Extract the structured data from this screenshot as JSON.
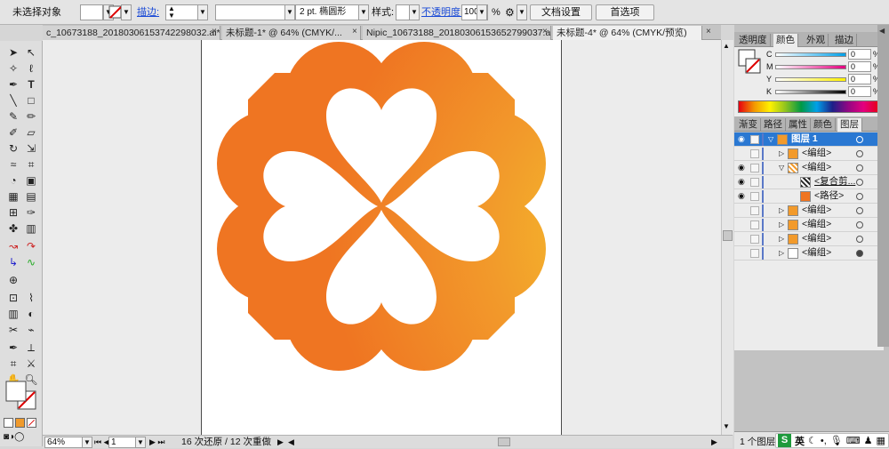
{
  "control": {
    "selection": "未选择对象",
    "stroke_label": "描边:",
    "stroke_preset": "2 pt. 椭圆形",
    "style_label": "样式:",
    "opacity_label": "不透明度:",
    "opacity_value": "100",
    "percent": "%",
    "doc_setup": "文档设置",
    "preferences": "首选项"
  },
  "tabs": [
    {
      "label": "c_10673188_20180306153742298032.ai*",
      "close": "×"
    },
    {
      "label": "未标题-1* @ 64% (CMYK/...",
      "close": "×"
    },
    {
      "label": "Nipic_10673188_20180306153652799037.ai*",
      "close": "×"
    },
    {
      "label": "未标题-4* @ 64% (CMYK/预览)",
      "close": "×"
    }
  ],
  "color_panel": {
    "tabs": [
      "透明度",
      "颜色",
      "外观",
      "描边"
    ],
    "channels": [
      {
        "label": "C",
        "value": "0",
        "pct": "%"
      },
      {
        "label": "M",
        "value": "0",
        "pct": "%"
      },
      {
        "label": "Y",
        "value": "0",
        "pct": "%"
      },
      {
        "label": "K",
        "value": "0",
        "pct": "%"
      }
    ]
  },
  "layers_panel": {
    "tabs": [
      "渐变",
      "路径",
      "属性",
      "颜色",
      "图层"
    ],
    "rows": [
      {
        "label": "图层 1",
        "level": 0,
        "expanded": true
      },
      {
        "label": "<编组>",
        "level": 1
      },
      {
        "label": "<编组>",
        "level": 1,
        "expanded": true
      },
      {
        "label": "<复合剪...",
        "level": 2
      },
      {
        "label": "<路径>",
        "level": 2
      },
      {
        "label": "<编组>",
        "level": 1
      },
      {
        "label": "<编组>",
        "level": 1
      },
      {
        "label": "<编组>",
        "level": 1
      },
      {
        "label": "<编组>",
        "level": 1
      }
    ],
    "footer": "1 个图层"
  },
  "status": {
    "zoom": "64%",
    "page": "1",
    "undo": "16 次还原 / 12 次重做"
  },
  "colors": {
    "gradient_top": "#f5c92c",
    "gradient_mid": "#f29a2b",
    "gradient_bottom": "#ef7522",
    "layer_select": "#2a78d2"
  },
  "ime": {
    "label": "英"
  }
}
